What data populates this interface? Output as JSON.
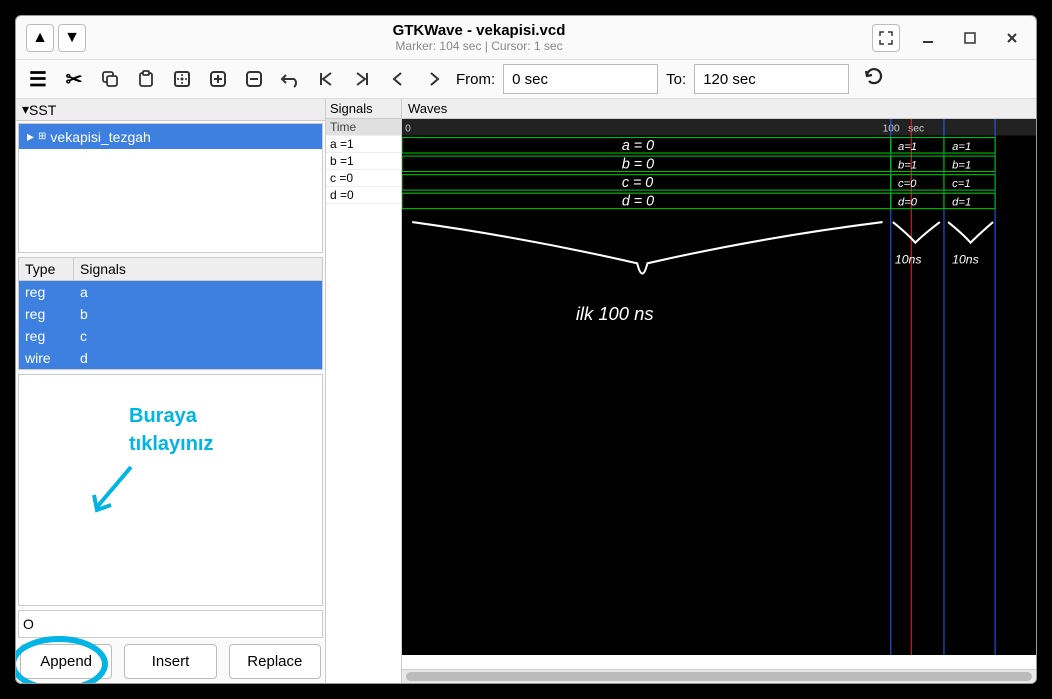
{
  "title": "GTKWave - vekapisi.vcd",
  "subtitle": "Marker: 104 sec  |  Cursor: 1 sec",
  "from_label": "From:",
  "from_value": "0 sec",
  "to_label": "To:",
  "to_value": "120 sec",
  "sst": {
    "header": "SST",
    "tree_item": "vekapisi_tezgah"
  },
  "sig_headers": {
    "type": "Type",
    "signals": "Signals"
  },
  "sig_rows": [
    {
      "type": "reg",
      "name": "a"
    },
    {
      "type": "reg",
      "name": "b"
    },
    {
      "type": "reg",
      "name": "c"
    },
    {
      "type": "wire",
      "name": "d"
    }
  ],
  "annotation": {
    "line1": "Buraya",
    "line2": "tıklayınız"
  },
  "filter_value": "O",
  "buttons": {
    "append": "Append",
    "insert": "Insert",
    "replace": "Replace"
  },
  "signals_panel": {
    "header": "Signals",
    "time_label": "Time",
    "rows": [
      "a =1",
      "b =1",
      "c =0",
      "d =0"
    ]
  },
  "waves": {
    "header": "Waves",
    "ruler": {
      "t0": "0",
      "t1": "100",
      "unit": "sec"
    },
    "annotations": {
      "main_brace_label": "ilk   100 ns",
      "row_labels_0_100": [
        "a = 0",
        "b = 0",
        "c = 0",
        "d = 0"
      ],
      "row_labels_100_110": [
        "a = 1",
        "b = 1",
        "c = 0",
        "d = 0"
      ],
      "row_labels_110_120": [
        "a = 1",
        "b = 1",
        "c = 1",
        "d = 1"
      ],
      "brace2": "10ns",
      "brace3": "10ns"
    }
  }
}
